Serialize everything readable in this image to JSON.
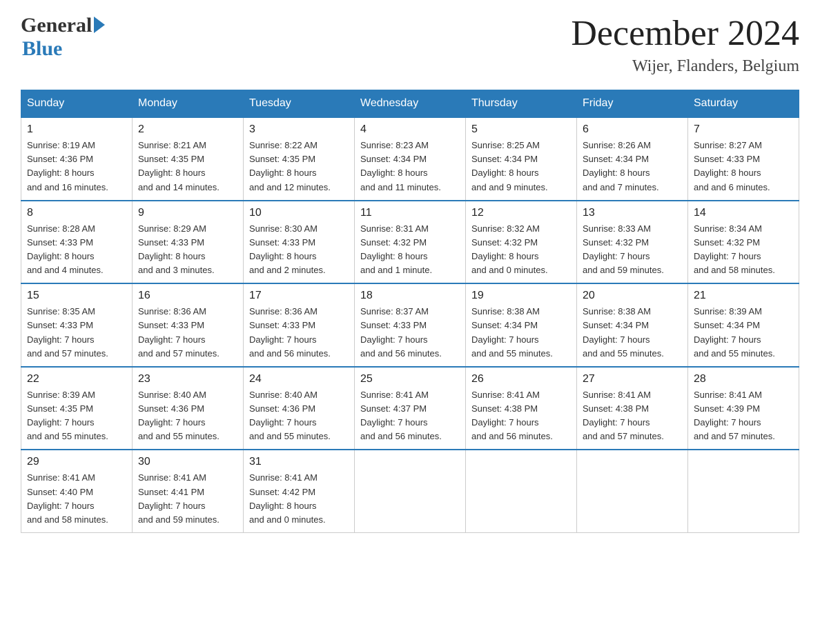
{
  "header": {
    "month_year": "December 2024",
    "location": "Wijer, Flanders, Belgium",
    "logo_general": "General",
    "logo_blue": "Blue"
  },
  "days_of_week": [
    "Sunday",
    "Monday",
    "Tuesday",
    "Wednesday",
    "Thursday",
    "Friday",
    "Saturday"
  ],
  "weeks": [
    [
      {
        "day": "1",
        "sunrise": "8:19 AM",
        "sunset": "4:36 PM",
        "daylight": "8 hours and 16 minutes."
      },
      {
        "day": "2",
        "sunrise": "8:21 AM",
        "sunset": "4:35 PM",
        "daylight": "8 hours and 14 minutes."
      },
      {
        "day": "3",
        "sunrise": "8:22 AM",
        "sunset": "4:35 PM",
        "daylight": "8 hours and 12 minutes."
      },
      {
        "day": "4",
        "sunrise": "8:23 AM",
        "sunset": "4:34 PM",
        "daylight": "8 hours and 11 minutes."
      },
      {
        "day": "5",
        "sunrise": "8:25 AM",
        "sunset": "4:34 PM",
        "daylight": "8 hours and 9 minutes."
      },
      {
        "day": "6",
        "sunrise": "8:26 AM",
        "sunset": "4:34 PM",
        "daylight": "8 hours and 7 minutes."
      },
      {
        "day": "7",
        "sunrise": "8:27 AM",
        "sunset": "4:33 PM",
        "daylight": "8 hours and 6 minutes."
      }
    ],
    [
      {
        "day": "8",
        "sunrise": "8:28 AM",
        "sunset": "4:33 PM",
        "daylight": "8 hours and 4 minutes."
      },
      {
        "day": "9",
        "sunrise": "8:29 AM",
        "sunset": "4:33 PM",
        "daylight": "8 hours and 3 minutes."
      },
      {
        "day": "10",
        "sunrise": "8:30 AM",
        "sunset": "4:33 PM",
        "daylight": "8 hours and 2 minutes."
      },
      {
        "day": "11",
        "sunrise": "8:31 AM",
        "sunset": "4:32 PM",
        "daylight": "8 hours and 1 minute."
      },
      {
        "day": "12",
        "sunrise": "8:32 AM",
        "sunset": "4:32 PM",
        "daylight": "8 hours and 0 minutes."
      },
      {
        "day": "13",
        "sunrise": "8:33 AM",
        "sunset": "4:32 PM",
        "daylight": "7 hours and 59 minutes."
      },
      {
        "day": "14",
        "sunrise": "8:34 AM",
        "sunset": "4:32 PM",
        "daylight": "7 hours and 58 minutes."
      }
    ],
    [
      {
        "day": "15",
        "sunrise": "8:35 AM",
        "sunset": "4:33 PM",
        "daylight": "7 hours and 57 minutes."
      },
      {
        "day": "16",
        "sunrise": "8:36 AM",
        "sunset": "4:33 PM",
        "daylight": "7 hours and 57 minutes."
      },
      {
        "day": "17",
        "sunrise": "8:36 AM",
        "sunset": "4:33 PM",
        "daylight": "7 hours and 56 minutes."
      },
      {
        "day": "18",
        "sunrise": "8:37 AM",
        "sunset": "4:33 PM",
        "daylight": "7 hours and 56 minutes."
      },
      {
        "day": "19",
        "sunrise": "8:38 AM",
        "sunset": "4:34 PM",
        "daylight": "7 hours and 55 minutes."
      },
      {
        "day": "20",
        "sunrise": "8:38 AM",
        "sunset": "4:34 PM",
        "daylight": "7 hours and 55 minutes."
      },
      {
        "day": "21",
        "sunrise": "8:39 AM",
        "sunset": "4:34 PM",
        "daylight": "7 hours and 55 minutes."
      }
    ],
    [
      {
        "day": "22",
        "sunrise": "8:39 AM",
        "sunset": "4:35 PM",
        "daylight": "7 hours and 55 minutes."
      },
      {
        "day": "23",
        "sunrise": "8:40 AM",
        "sunset": "4:36 PM",
        "daylight": "7 hours and 55 minutes."
      },
      {
        "day": "24",
        "sunrise": "8:40 AM",
        "sunset": "4:36 PM",
        "daylight": "7 hours and 55 minutes."
      },
      {
        "day": "25",
        "sunrise": "8:41 AM",
        "sunset": "4:37 PM",
        "daylight": "7 hours and 56 minutes."
      },
      {
        "day": "26",
        "sunrise": "8:41 AM",
        "sunset": "4:38 PM",
        "daylight": "7 hours and 56 minutes."
      },
      {
        "day": "27",
        "sunrise": "8:41 AM",
        "sunset": "4:38 PM",
        "daylight": "7 hours and 57 minutes."
      },
      {
        "day": "28",
        "sunrise": "8:41 AM",
        "sunset": "4:39 PM",
        "daylight": "7 hours and 57 minutes."
      }
    ],
    [
      {
        "day": "29",
        "sunrise": "8:41 AM",
        "sunset": "4:40 PM",
        "daylight": "7 hours and 58 minutes."
      },
      {
        "day": "30",
        "sunrise": "8:41 AM",
        "sunset": "4:41 PM",
        "daylight": "7 hours and 59 minutes."
      },
      {
        "day": "31",
        "sunrise": "8:41 AM",
        "sunset": "4:42 PM",
        "daylight": "8 hours and 0 minutes."
      },
      null,
      null,
      null,
      null
    ]
  ],
  "labels": {
    "sunrise": "Sunrise:",
    "sunset": "Sunset:",
    "daylight": "Daylight:"
  }
}
